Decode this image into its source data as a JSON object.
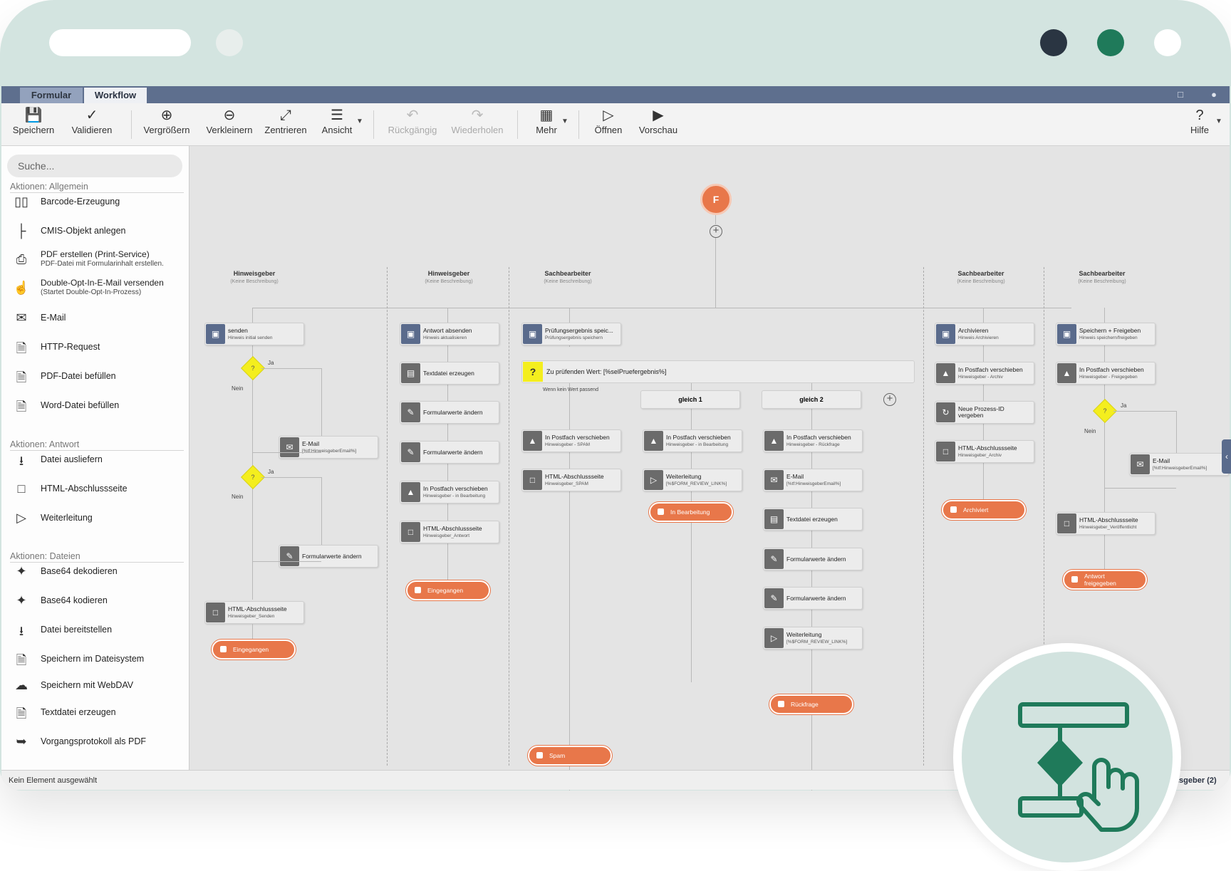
{
  "tabs": [
    "Formular",
    "Workflow"
  ],
  "toolbar": {
    "save": "Speichern",
    "validate": "Validieren",
    "zoom_in": "Vergrößern",
    "zoom_out": "Verkleinern",
    "center": "Zentrieren",
    "view": "Ansicht",
    "undo": "Rückgängig",
    "redo": "Wiederholen",
    "more": "Mehr",
    "open": "Öffnen",
    "preview": "Vorschau",
    "help": "Hilfe"
  },
  "sidebar": {
    "search_placeholder": "Suche...",
    "sections": [
      {
        "title": "Aktionen: Allgemein",
        "items": [
          {
            "label": "Barcode-Erzeugung",
            "icon": "barcode-icon"
          },
          {
            "label": "CMIS-Objekt anlegen",
            "icon": "tree-icon"
          },
          {
            "label": "PDF erstellen (Print-Service)",
            "sub": "PDF-Datei mit Formularinhalt erstellen.",
            "icon": "printer-icon"
          },
          {
            "label": "Double-Opt-In-E-Mail versenden",
            "sub": "(Startet Double-Opt-In-Prozess)",
            "icon": "hand-pointer-icon"
          },
          {
            "label": "E-Mail",
            "icon": "envelope-icon"
          },
          {
            "label": "HTTP-Request",
            "icon": "files-icon"
          },
          {
            "label": "PDF-Datei befüllen",
            "icon": "pdf-icon"
          },
          {
            "label": "Word-Datei befüllen",
            "icon": "word-icon"
          }
        ]
      },
      {
        "title": "Aktionen: Antwort",
        "items": [
          {
            "label": "Datei ausliefern",
            "icon": "file-download-icon"
          },
          {
            "label": "HTML-Abschlussseite",
            "icon": "file-dashed-icon"
          },
          {
            "label": "Weiterleitung",
            "icon": "file-forward-icon"
          }
        ]
      },
      {
        "title": "Aktionen: Dateien",
        "items": [
          {
            "label": "Base64 dekodieren",
            "icon": "magic-wand-icon"
          },
          {
            "label": "Base64 kodieren",
            "icon": "magic-wand-icon"
          },
          {
            "label": "Datei bereitstellen",
            "icon": "download-tray-icon"
          },
          {
            "label": "Speichern im Dateisystem",
            "icon": "file-save-icon"
          },
          {
            "label": "Speichern mit WebDAV",
            "icon": "cloud-upload-icon"
          },
          {
            "label": "Textdatei erzeugen",
            "icon": "file-text-icon"
          },
          {
            "label": "Vorgangsprotokoll als PDF",
            "icon": "file-export-icon"
          }
        ]
      }
    ]
  },
  "lanes": [
    {
      "title": "Hinweisgeber",
      "desc": "(Keine Beschreibung)"
    },
    {
      "title": "Hinweisgeber",
      "desc": "(Keine Beschreibung)"
    },
    {
      "title": "Sachbearbeiter",
      "desc": "(Keine Beschreibung)"
    },
    {
      "title": "Sachbearbeiter",
      "desc": "(Keine Beschreibung)"
    },
    {
      "title": "Sachbearbeiter",
      "desc": "(Keine Beschreibung)"
    }
  ],
  "nodes": {
    "l1_start": {
      "title": "senden",
      "sub": "Hinweis initial senden"
    },
    "l1_email": {
      "title": "E-Mail",
      "sub": "[%tf:HinweisgeberEmail%]"
    },
    "l1_form": {
      "title": "Formularwerte ändern"
    },
    "l1_html": {
      "title": "HTML-Abschlussseite",
      "sub": "Hinweisgeber_Senden"
    },
    "l1_end": "Eingegangen",
    "l2_start": {
      "title": "Antwort absenden",
      "sub": "Hinweis aktualisieren"
    },
    "l2_text": {
      "title": "Textdatei erzeugen"
    },
    "l2_form1": {
      "title": "Formularwerte ändern"
    },
    "l2_form2": {
      "title": "Formularwerte ändern"
    },
    "l2_move": {
      "title": "In Postfach verschieben",
      "sub": "Hinweisgeber - in Bearbeitung"
    },
    "l2_html": {
      "title": "HTML-Abschlussseite",
      "sub": "Hinweisgeber_Antwort"
    },
    "l2_end": "Eingegangen",
    "l3_start": {
      "title": "Prüfungsergebnis speic...",
      "sub": "Prüfungsergebnis speichern"
    },
    "l3_switch": "Zu prüfenden Wert: [%selPruefergebnis%]",
    "l3_default": "Wenn kein Wert passend",
    "l3_case1": "gleich 1",
    "l3_case2": "gleich 2",
    "l3_a_move": {
      "title": "In Postfach verschieben",
      "sub": "Hinweisgeber - SPAM"
    },
    "l3_a_html": {
      "title": "HTML-Abschlussseite",
      "sub": "Hinweisgeber_SPAM"
    },
    "l3_a_end": "Spam",
    "l3_b_move": {
      "title": "In Postfach verschieben",
      "sub": "Hinweisgeber - in Bearbeitung"
    },
    "l3_b_fwd": {
      "title": "Weiterleitung",
      "sub": "[%$FORM_REVIEW_LINK%]"
    },
    "l3_b_end": "In Bearbeitung",
    "l3_c_move": {
      "title": "In Postfach verschieben",
      "sub": "Hinweisgeber - Rückfrage"
    },
    "l3_c_email": {
      "title": "E-Mail",
      "sub": "[%tf:HinweisgeberEmail%]"
    },
    "l3_c_text": {
      "title": "Textdatei erzeugen"
    },
    "l3_c_form1": {
      "title": "Formularwerte ändern"
    },
    "l3_c_form2": {
      "title": "Formularwerte ändern"
    },
    "l3_c_fwd": {
      "title": "Weiterleitung",
      "sub": "[%$FORM_REVIEW_LINK%]"
    },
    "l3_c_end": "Rückfrage",
    "l4_start": {
      "title": "Archivieren",
      "sub": "Hinweis Archivieren"
    },
    "l4_move": {
      "title": "In Postfach verschieben",
      "sub": "Hinweisgeber - Archiv"
    },
    "l4_pid": {
      "title": "Neue Prozess-ID",
      "sub2": "vergeben"
    },
    "l4_html": {
      "title": "HTML-Abschlussseite",
      "sub": "Hinweisgeber_Archiv"
    },
    "l4_end": "Archiviert",
    "l5_start": {
      "title": "Speichern + Freigeben",
      "sub": "Hinweis speichern/freigeben"
    },
    "l5_move": {
      "title": "In Postfach verschieben",
      "sub": "Hinweisgeber - Freigegeben"
    },
    "l5_email": {
      "title": "E-Mail",
      "sub": "[%tf:HinweisgeberEmail%]"
    },
    "l5_html": {
      "title": "HTML-Abschlussseite",
      "sub": "Hinweisgeber_Veröffentlicht"
    },
    "l5_end1": "Antwort",
    "l5_end2": "freigegeben"
  },
  "decisions": {
    "yes": "Ja",
    "no": "Nein",
    "q": "?"
  },
  "status": {
    "left": "Kein Element ausgewählt",
    "right": "isgeber (2)"
  },
  "colors": {
    "accent": "#e8774a",
    "frame": "#d3e4e0",
    "brand_green": "#1f7a5a",
    "tabbar": "#5e6f8e"
  }
}
